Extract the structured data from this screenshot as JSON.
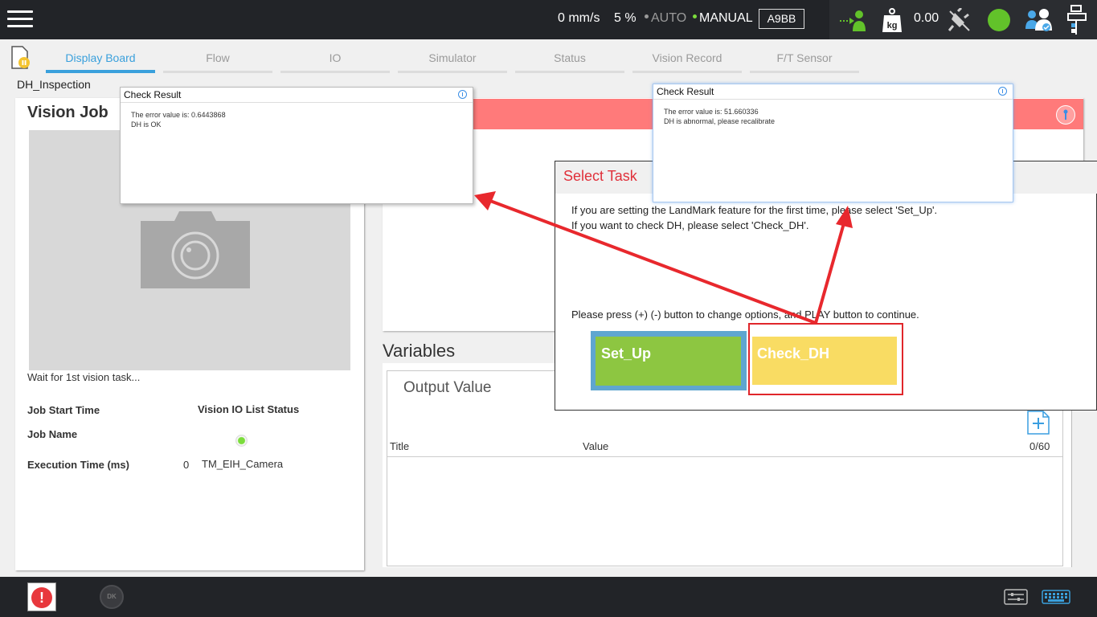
{
  "topbar": {
    "speed": "0 mm/s",
    "percent": "5 %",
    "auto_label": "AUTO",
    "manual_label": "MANUAL",
    "robot_code": "A9BB",
    "weight": "0.00",
    "colors": {
      "active_dot": "#7bdc3c",
      "inactive_dot": "#9a9a9a",
      "status_green": "#62c22a"
    }
  },
  "tabs": [
    {
      "label": "Display Board",
      "active": true
    },
    {
      "label": "Flow"
    },
    {
      "label": "IO"
    },
    {
      "label": "Simulator"
    },
    {
      "label": "Status"
    },
    {
      "label": "Vision Record"
    },
    {
      "label": "F/T Sensor"
    }
  ],
  "project_name": "DH_Inspection",
  "vision_job": {
    "title": "Vision Job",
    "wait_text": "Wait for 1st vision task...",
    "job_start_time_label": "Job Start Time",
    "vision_io_status_label": "Vision IO List Status",
    "job_name_label": "Job Name",
    "execution_time_label": "Execution Time (ms)",
    "execution_time_value": "0",
    "camera_name": "TM_EIH_Camera"
  },
  "variables": {
    "title": "Variables",
    "output_title": "Output Value",
    "col_title": "Title",
    "col_value": "Value",
    "count": "0/60"
  },
  "select_task": {
    "title": "Select Task",
    "line1": "If you are setting the LandMark feature for the first time, please select 'Set_Up'.",
    "line2": "If you want to check DH, please select 'Check_DH'.",
    "instruction": "Please press (+) (-) button to change options, and PLAY button to continue.",
    "option_setup": "Set_Up",
    "option_check": "Check_DH"
  },
  "check_result_left": {
    "title": "Check Result",
    "line1": "The error value is: 0.6443868",
    "line2": "DH is OK"
  },
  "check_result_right": {
    "title": "Check Result",
    "line1": "The error value is: 51.660336",
    "line2": "DH is abnormal, please recalibrate"
  },
  "bottombar": {
    "alert_symbol": "!",
    "dk_label": "DK"
  },
  "icons": [
    "menu-icon",
    "robot-user-icon",
    "weight-kg-icon",
    "plug-icon",
    "status-circle-icon",
    "users-icon",
    "io-icon",
    "project-doc-icon",
    "camera-icon",
    "pin-icon",
    "add-file-icon",
    "alert-icon",
    "dk-icon",
    "controller-icon",
    "keyboard-icon"
  ]
}
